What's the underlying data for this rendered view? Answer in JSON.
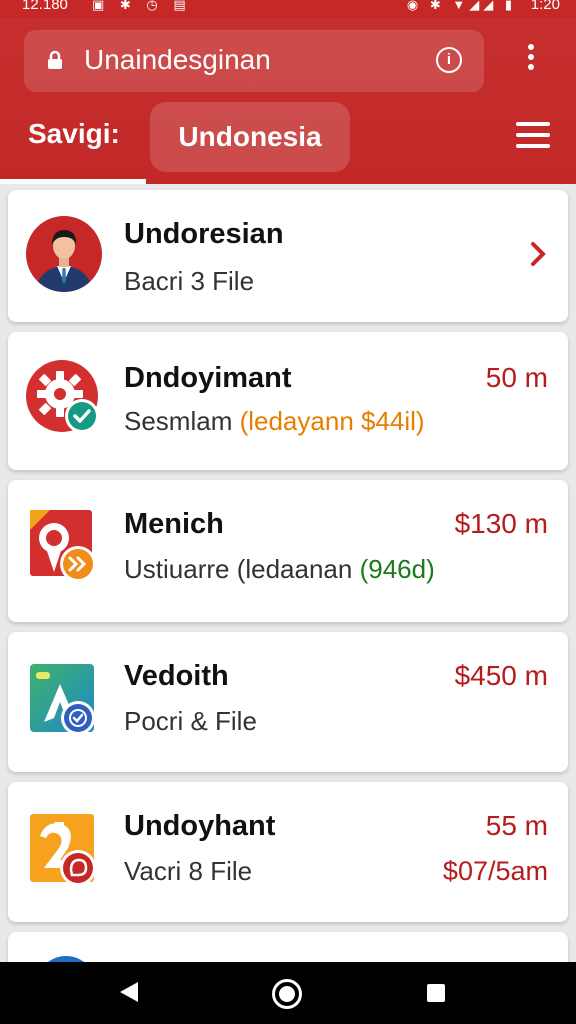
{
  "status_bar": {
    "time_left": "12.180",
    "time_right": "1:20",
    "icons_left": "▣ ✱ ◷ ▤",
    "icons_right": "◉ ✱ ▼◢◢ ▮"
  },
  "header": {
    "search_text": "Unaindesginan",
    "tab_label": "Savigi:",
    "chip_label": "Undonesia",
    "colors": {
      "primary": "#c62828",
      "amount": "#b71c1c",
      "orange": "#e67e00",
      "green": "#1b7a1b"
    }
  },
  "items": [
    {
      "title": "Undoresian",
      "subtitle": "Bacri 3 File",
      "trailing_icon": "chevron-right-icon",
      "avatar": "person-avatar"
    },
    {
      "title": "Dndoyimant",
      "subtitle_prefix": "Sesmlam ",
      "subtitle_highlight": "(ledayann $44il)",
      "amount": "50 m",
      "avatar": "gear-check-icon"
    },
    {
      "title": "Menich",
      "subtitle_prefix": "Ustiuarre (ledaanan ",
      "subtitle_highlight": "(946d)",
      "amount": "$130 m",
      "avatar": "pin-forward-icon"
    },
    {
      "title": "Vedoith",
      "subtitle": "Pocri & File",
      "amount": "$450 m",
      "avatar": "app-verified-icon"
    },
    {
      "title": "Undoyhant",
      "subtitle": "Vacri 8 File",
      "amount": "55 m",
      "amount_secondary": "$07/5am",
      "avatar": "shape-badge-icon"
    }
  ]
}
